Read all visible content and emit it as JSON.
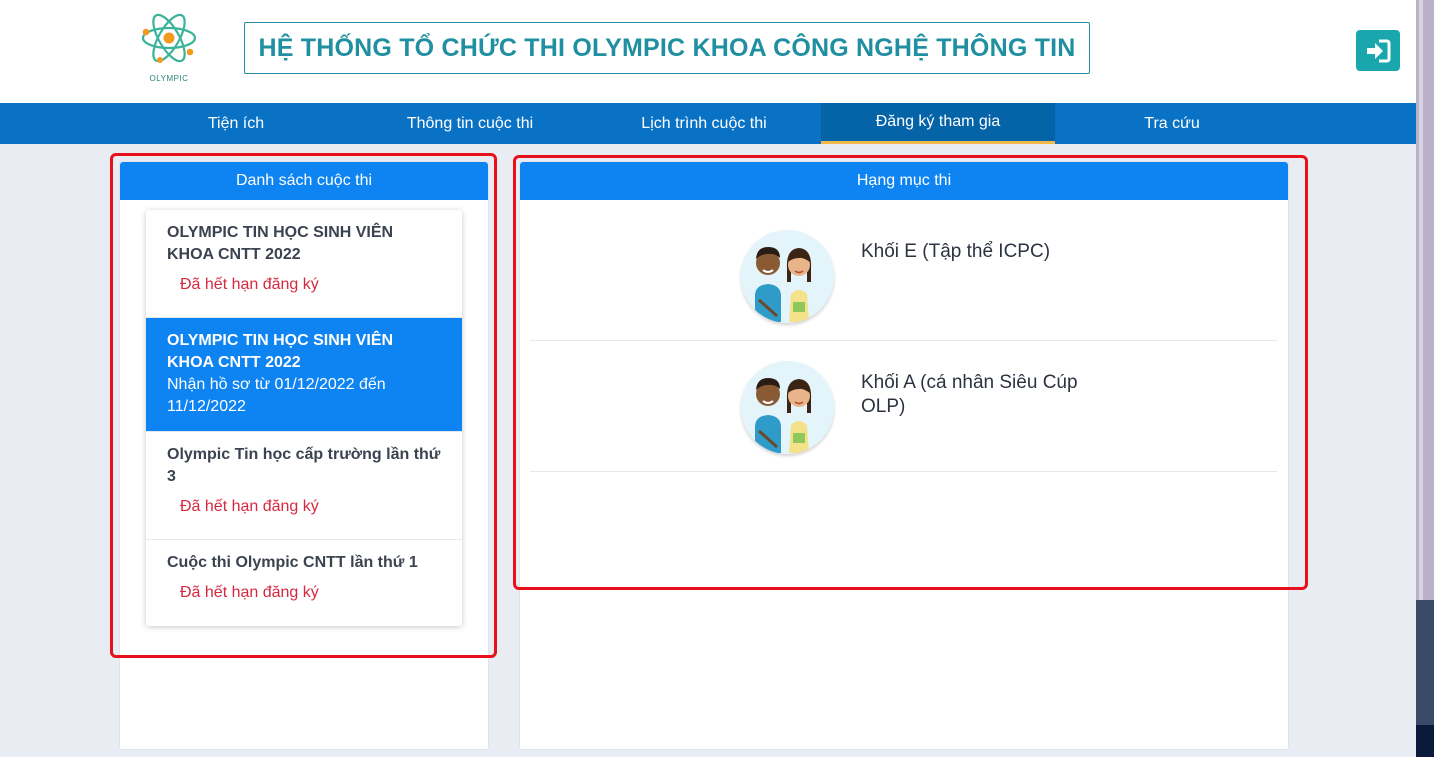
{
  "header": {
    "logo_text": "OLYMPIC",
    "title": "HỆ THỐNG TỔ CHỨC THI OLYMPIC KHOA CÔNG NGHỆ THÔNG TIN",
    "logout_icon": "sign-in-icon"
  },
  "nav": {
    "items": [
      {
        "label": "Tiện ích"
      },
      {
        "label": "Thông tin cuộc thi"
      },
      {
        "label": "Lịch trình cuộc thi"
      },
      {
        "label": "Đăng ký tham gia",
        "active": true
      },
      {
        "label": "Tra cứu"
      }
    ]
  },
  "competitions": {
    "header": "Danh sách cuộc thi",
    "items": [
      {
        "name": "OLYMPIC TIN HỌC SINH VIÊN KHOA CNTT 2022",
        "status": "Đã hết hạn đăng ký"
      },
      {
        "name": "OLYMPIC TIN HỌC SINH VIÊN KHOA CNTT 2022",
        "period": "Nhận hồ sơ từ 01/12/2022 đến 11/12/2022",
        "active": true
      },
      {
        "name": "Olympic Tin học cấp trường lần thứ 3",
        "status": "Đã hết hạn đăng ký"
      },
      {
        "name": "Cuộc thi Olympic CNTT lần thứ 1",
        "status": "Đã hết hạn đăng ký"
      }
    ]
  },
  "categories": {
    "header": "Hạng mục thi",
    "items": [
      {
        "label": "Khối E (Tập thể ICPC)",
        "icon": "students-avatar-icon"
      },
      {
        "label": "Khối A (cá nhân Siêu Cúp OLP)",
        "icon": "students-avatar-icon"
      }
    ]
  },
  "colors": {
    "primary": "#0d84f2",
    "nav": "#0a72c4",
    "title": "#1f8fa1",
    "expired": "#d7283f",
    "highlight": "#e8101a"
  }
}
